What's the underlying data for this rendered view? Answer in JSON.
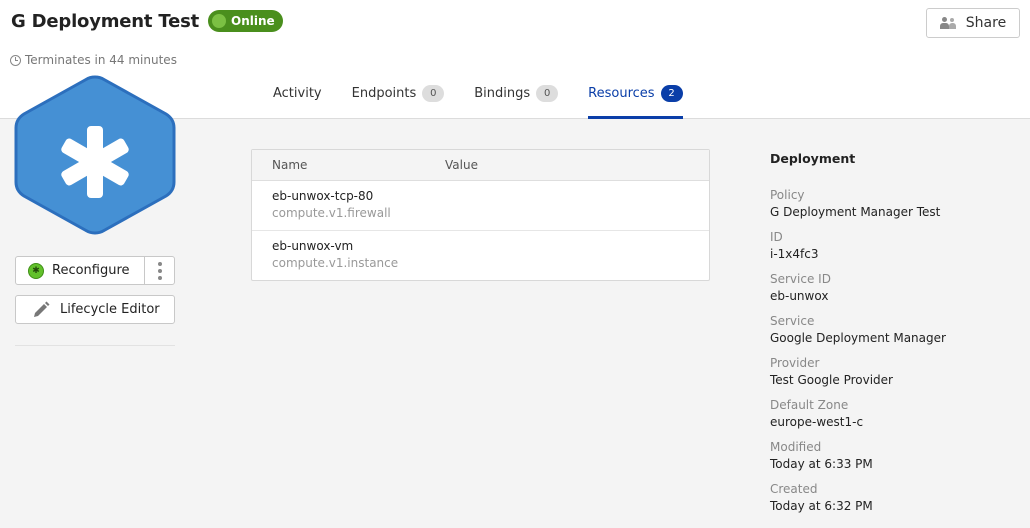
{
  "header": {
    "title": "G Deployment Test",
    "status": "Online",
    "status_color": "#4a8f1d",
    "terminates": "Terminates in 44 minutes",
    "share_label": "Share"
  },
  "tabs": [
    {
      "label": "Activity",
      "count": null,
      "active": false
    },
    {
      "label": "Endpoints",
      "count": "0",
      "active": false
    },
    {
      "label": "Bindings",
      "count": "0",
      "active": false
    },
    {
      "label": "Resources",
      "count": "2",
      "active": true
    }
  ],
  "accent_color": "#0a3ea8",
  "actions": {
    "reconfigure_label": "Reconfigure",
    "lifecycle_label": "Lifecycle Editor"
  },
  "resources": {
    "columns": [
      "Name",
      "Value"
    ],
    "rows": [
      {
        "name": "eb-unwox-tcp-80",
        "type": "compute.v1.firewall"
      },
      {
        "name": "eb-unwox-vm",
        "type": "compute.v1.instance"
      }
    ]
  },
  "details": {
    "title": "Deployment",
    "fields": [
      {
        "label": "Policy",
        "value": "G Deployment Manager Test"
      },
      {
        "label": "ID",
        "value": "i-1x4fc3"
      },
      {
        "label": "Service ID",
        "value": "eb-unwox"
      },
      {
        "label": "Service",
        "value": "Google Deployment Manager"
      },
      {
        "label": "Provider",
        "value": "Test Google Provider"
      },
      {
        "label": "Default Zone",
        "value": "europe-west1-c"
      },
      {
        "label": "Modified",
        "value": "Today at 6:33 PM"
      },
      {
        "label": "Created",
        "value": "Today at 6:32 PM"
      }
    ]
  }
}
